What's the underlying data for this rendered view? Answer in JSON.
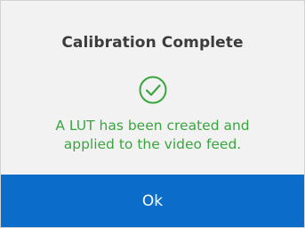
{
  "dialog": {
    "title": "Calibration Complete",
    "status_icon": "check-circle-icon",
    "message_line1": "A LUT has been created and",
    "message_line2": "applied to the video feed.",
    "ok_label": "Ok"
  },
  "colors": {
    "background": "#f2f2f2",
    "title_text": "#3c3c3c",
    "success_green": "#3aa53f",
    "button_blue": "#0b6cc9",
    "button_text": "#ffffff"
  }
}
